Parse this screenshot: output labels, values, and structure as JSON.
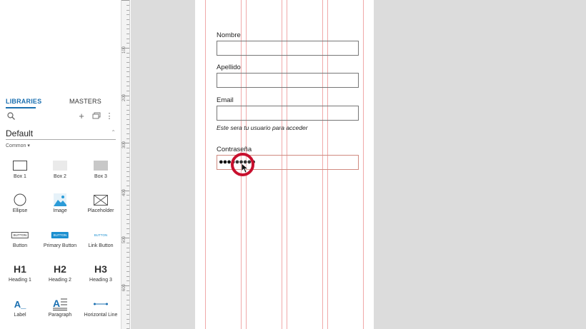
{
  "left_panel": {
    "tabs": {
      "libraries": "LIBRARIES",
      "masters": "MASTERS"
    },
    "library": {
      "name": "Default"
    },
    "category": "Common ▾",
    "widgets": [
      {
        "label": "Box 1",
        "icon": "box-outline-icon"
      },
      {
        "label": "Box 2",
        "icon": "box-light-gray-icon"
      },
      {
        "label": "Box 3",
        "icon": "box-gray-icon"
      },
      {
        "label": "Ellipse",
        "icon": "ellipse-icon"
      },
      {
        "label": "Image",
        "icon": "image-icon"
      },
      {
        "label": "Placeholder",
        "icon": "placeholder-icon"
      },
      {
        "label": "Button",
        "icon": "button-icon",
        "thumb_text": "BUTTON"
      },
      {
        "label": "Primary Button",
        "icon": "primary-button-icon",
        "thumb_text": "BUTTON"
      },
      {
        "label": "Link Button",
        "icon": "link-button-icon",
        "thumb_text": "BUTTON"
      },
      {
        "label": "Heading 1",
        "icon": "heading1-icon",
        "thumb_text": "H1"
      },
      {
        "label": "Heading 2",
        "icon": "heading2-icon",
        "thumb_text": "H2"
      },
      {
        "label": "Heading 3",
        "icon": "heading3-icon",
        "thumb_text": "H3"
      },
      {
        "label": "Label",
        "icon": "label-icon",
        "thumb_text": "A_"
      },
      {
        "label": "Paragraph",
        "icon": "paragraph-icon",
        "thumb_text": "A"
      },
      {
        "label": "Horizontal Line",
        "icon": "horizontal-line-icon"
      }
    ]
  },
  "ruler": {
    "labels": [
      "100",
      "200",
      "300",
      "400",
      "500",
      "600"
    ]
  },
  "form": {
    "nombre_label": "Nombre",
    "apellido_label": "Apellido",
    "email_label": "Email",
    "email_hint": "Este sera tu usuario para acceder",
    "password_label": "Contraseña",
    "password_value": "●●●●●●●●●"
  },
  "colors": {
    "accent": "#1a6fb0",
    "canvas_bg": "#dcdcdc",
    "guide": "#f0a9a9",
    "click_marker": "#c8102e",
    "primary_button": "#1a8fd0"
  }
}
